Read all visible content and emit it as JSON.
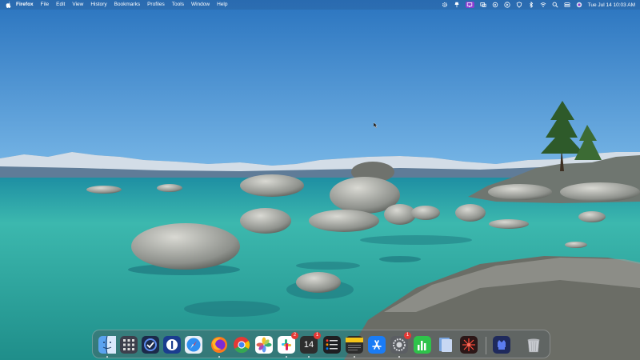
{
  "menubar": {
    "app_name": "Firefox",
    "menus": [
      "File",
      "Edit",
      "View",
      "History",
      "Bookmarks",
      "Profiles",
      "Tools",
      "Window",
      "Help"
    ],
    "status_icons": [
      "gear-icon",
      "lamp-icon",
      "display-icon",
      "screen-mirror-icon",
      "eye-icon",
      "play-icon",
      "vpn-icon",
      "bluetooth-icon",
      "wifi-icon",
      "search-icon",
      "control-center-icon",
      "siri-icon"
    ],
    "clock": "Tue Jul 14  10:03 AM"
  },
  "dock": {
    "apps": [
      {
        "name": "Finder",
        "running": true
      },
      {
        "name": "Launchpad",
        "running": false
      },
      {
        "name": "OmniFocus",
        "running": false
      },
      {
        "name": "1Password",
        "running": false
      },
      {
        "name": "Safari",
        "running": false
      },
      {
        "name": "Firefox",
        "running": true
      },
      {
        "name": "Chrome",
        "running": false
      },
      {
        "name": "Photos",
        "running": false
      },
      {
        "name": "Slack",
        "running": true,
        "badge": "2"
      },
      {
        "name": "Calendar",
        "running": true,
        "badge": "1",
        "label": "14"
      },
      {
        "name": "Reminders",
        "running": false
      },
      {
        "name": "Notes",
        "running": true
      },
      {
        "name": "App Store",
        "running": false
      },
      {
        "name": "System Settings",
        "running": true,
        "badge": "1"
      },
      {
        "name": "Numbers",
        "running": false
      },
      {
        "name": "Preview",
        "running": false
      },
      {
        "name": "Scrobbles",
        "running": false
      },
      {
        "name": "Lock",
        "running": false
      },
      {
        "name": "Trash",
        "running": false
      }
    ]
  },
  "colors": {
    "sky_top": "#2e79c2",
    "sky_bottom": "#6fb2e6",
    "water": "#3bbab0",
    "accent_purple": "#8b3fd1",
    "badge_red": "#e53935"
  }
}
